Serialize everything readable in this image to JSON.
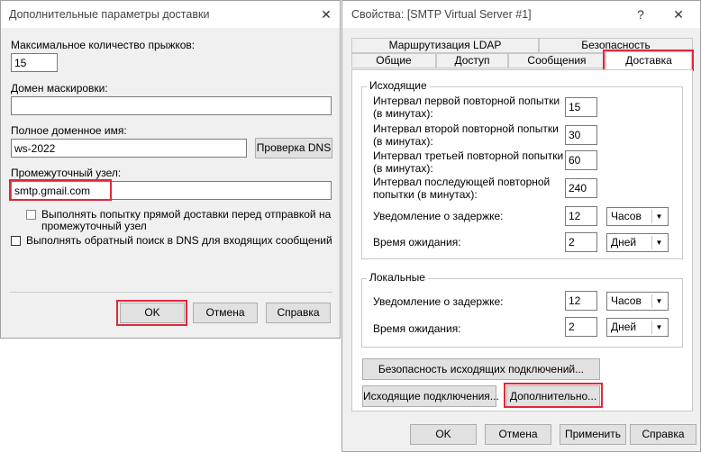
{
  "left_dialog": {
    "title": "Дополнительные параметры доставки",
    "close_glyph": "✕",
    "max_hops_label": "Максимальное количество прыжков:",
    "max_hops_value": "15",
    "masquerade_label": "Домен маскировки:",
    "masquerade_value": "",
    "fqdn_label": "Полное доменное имя:",
    "fqdn_value": "ws-2022",
    "check_dns_button": "Проверка DNS",
    "smarthost_label": "Промежуточный узел:",
    "smarthost_value": "smtp.gmail.com",
    "direct_delivery_line1": "Выполнять попытку прямой доставки перед отправкой на",
    "direct_delivery_line2": "промежуточный узел",
    "reverse_dns_label": "Выполнять обратный поиск в DNS для входящих сообщений",
    "ok_button": "OK",
    "cancel_button": "Отмена",
    "help_button": "Справка"
  },
  "right_dialog": {
    "title": "Свойства: [SMTP Virtual Server #1]",
    "help_glyph": "?",
    "close_glyph": "✕",
    "tabs_row1": [
      "Маршрутизация LDAP",
      "Безопасность"
    ],
    "tabs_row2": [
      "Общие",
      "Доступ",
      "Сообщения",
      "Доставка"
    ],
    "outgoing": {
      "group_label": "Исходящие",
      "first_retry_line1": "Интервал первой повторной попытки",
      "first_retry_line2": "(в минутах):",
      "first_retry_value": "15",
      "second_retry_line1": "Интервал второй повторной попытки",
      "second_retry_line2": "(в минутах):",
      "second_retry_value": "30",
      "third_retry_line1": "Интервал третьей повторной попытки",
      "third_retry_line2": "(в минутах):",
      "third_retry_value": "60",
      "subsequent_retry_line1": "Интервал последующей повторной",
      "subsequent_retry_line2": "попытки (в минутах):",
      "subsequent_retry_value": "240",
      "delay_label": "Уведомление о задержке:",
      "delay_value": "12",
      "delay_unit": "Часов",
      "expire_label": "Время ожидания:",
      "expire_value": "2",
      "expire_unit": "Дней"
    },
    "local": {
      "group_label": "Локальные",
      "delay_label": "Уведомление о задержке:",
      "delay_value": "12",
      "delay_unit": "Часов",
      "expire_label": "Время ожидания:",
      "expire_value": "2",
      "expire_unit": "Дней"
    },
    "outbound_security_button": "Безопасность исходящих подключений...",
    "outbound_connections_button": "Исходящие подключения...",
    "advanced_button": "Дополнительно...",
    "ok_button": "OK",
    "cancel_button": "Отмена",
    "apply_button": "Применить",
    "help_button": "Справка"
  }
}
